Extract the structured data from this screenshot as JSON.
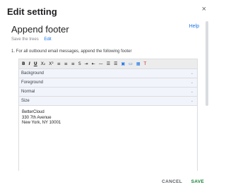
{
  "dialog": {
    "title": "Edit setting",
    "close_label": "×"
  },
  "section": {
    "title": "Append footer",
    "help_label": "Help"
  },
  "breadcrumb": {
    "text": "Save the trees",
    "edit_label": "Edit"
  },
  "instruction": "1. For all outbound email messages, append the following footer",
  "toolbar": {
    "buttons": [
      {
        "name": "bold-button",
        "glyph": "B",
        "style": "bold"
      },
      {
        "name": "italic-button",
        "glyph": "I",
        "style": "italic"
      },
      {
        "name": "underline-button",
        "glyph": "U",
        "style": "underline"
      },
      {
        "name": "subscript-button",
        "glyph": "X₂"
      },
      {
        "name": "superscript-button",
        "glyph": "X²"
      },
      {
        "name": "align-left-button",
        "glyph": "≡"
      },
      {
        "name": "align-center-button",
        "glyph": "≡"
      },
      {
        "name": "align-right-button",
        "glyph": "≡"
      },
      {
        "name": "strikethrough-button",
        "glyph": "S"
      },
      {
        "name": "indent-button",
        "glyph": "⇥"
      },
      {
        "name": "outdent-button",
        "glyph": "⇤"
      },
      {
        "name": "horizontal-rule-button",
        "glyph": "—"
      },
      {
        "name": "numbered-list-button",
        "glyph": "☰"
      },
      {
        "name": "bulleted-list-button",
        "glyph": "☰"
      },
      {
        "name": "image-button",
        "glyph": "▣",
        "color": "blue"
      },
      {
        "name": "link-button",
        "glyph": "▭",
        "color": "blue"
      },
      {
        "name": "table-button",
        "glyph": "▦",
        "color": "blue"
      },
      {
        "name": "clear-format-button",
        "glyph": "T",
        "color": "red"
      }
    ]
  },
  "selects": {
    "background": "Background",
    "foreground": "Foreground",
    "format": "Normal",
    "size": "Size"
  },
  "content": {
    "line1": "BetterCloud",
    "line2": "330 7th Avenue",
    "line3": "New York, NY 10001"
  },
  "footer": {
    "cancel_label": "CANCEL",
    "save_label": "SAVE"
  },
  "colors": {
    "accent": "#1a73e8",
    "save": "#188038",
    "toolbar_bg": "#ececec",
    "select_bg": "#f1f4fb"
  }
}
